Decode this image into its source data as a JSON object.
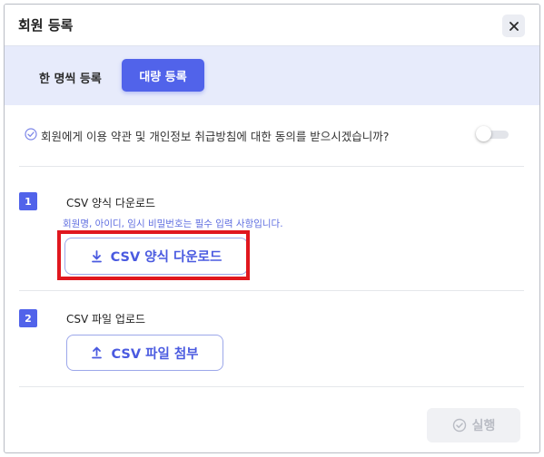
{
  "dialog": {
    "title": "회원 등록",
    "close_icon": "close-icon"
  },
  "tabs": [
    {
      "label": "한 명씩 등록",
      "active": false
    },
    {
      "label": "대량 등록",
      "active": true
    }
  ],
  "consent": {
    "icon": "check-circle-icon",
    "text": "회원에게 이용 약관 및 개인정보 취급방침에 대한 동의를 받으시겠습니까?",
    "toggle_on": false
  },
  "steps": [
    {
      "number": "1",
      "title": "CSV 양식 다운로드",
      "description": "회원명, 아이디, 임시 비밀번호는 필수 입력 사항입니다.",
      "button_label": "CSV 양식 다운로드",
      "button_icon": "download-icon"
    },
    {
      "number": "2",
      "title": "CSV 파일 업로드",
      "button_label": "CSV 파일 첨부",
      "button_icon": "upload-icon"
    }
  ],
  "footer": {
    "run_label": "실행",
    "run_icon": "check-circle-icon",
    "run_disabled": true
  },
  "colors": {
    "accent": "#5163ea",
    "tab_bar_bg": "#e7ebfb",
    "highlight": "#e0171e",
    "disabled_text": "#b9bcc4"
  }
}
